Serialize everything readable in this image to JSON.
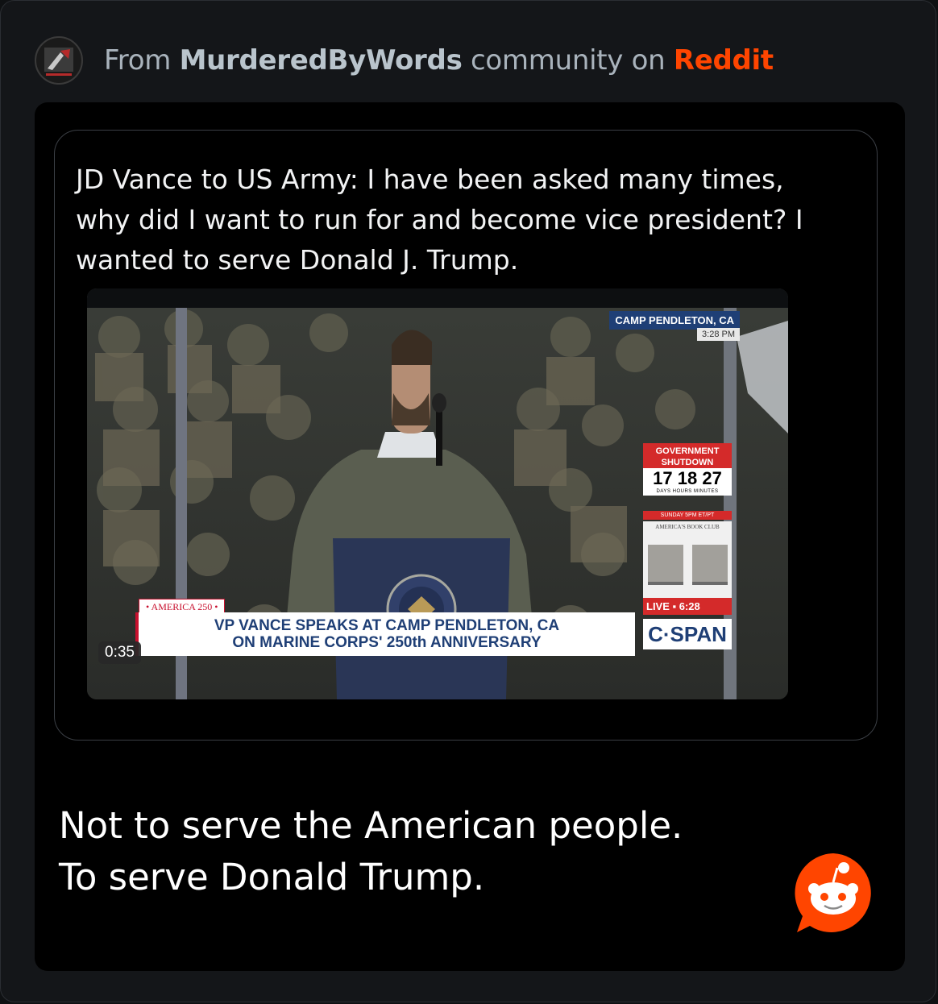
{
  "header": {
    "prefix": "From",
    "community": "MurderedByWords",
    "middle": "community on",
    "platform": "Reddit",
    "avatar_icon": "community-avatar-icon"
  },
  "post": {
    "title": "JD Vance to US Army:  I have been asked many times, why did I want to run for and become vice president? I wanted to serve Donald J. Trump.",
    "video": {
      "duration": "0:35",
      "location_tag": "CAMP PENDLETON, CA",
      "time_tag": "3:28 PM",
      "shutdown_title": "GOVERNMENT SHUTDOWN",
      "shutdown_count": "17 18 27",
      "shutdown_units": "DAYS HOURS MINUTES",
      "promo_time": "SUNDAY 5PM ET/PT",
      "promo_show": "AMERICA'S BOOK CLUB",
      "live_label": "LIVE ▪ 6:28",
      "network": "C·SPAN",
      "series_tag": "• AMERICA 250 •",
      "lower_third_line1": "VP VANCE SPEAKS AT CAMP PENDLETON, CA",
      "lower_third_line2": "ON MARINE CORPS' 250th ANNIVERSARY"
    }
  },
  "comment": {
    "line1": "Not to serve the American people.",
    "line2": "To serve Donald Trump."
  },
  "colors": {
    "reddit_orange": "#ff4500",
    "background": "#141619",
    "card": "#000000"
  },
  "icons": {
    "logo": "reddit-snoo-icon"
  }
}
